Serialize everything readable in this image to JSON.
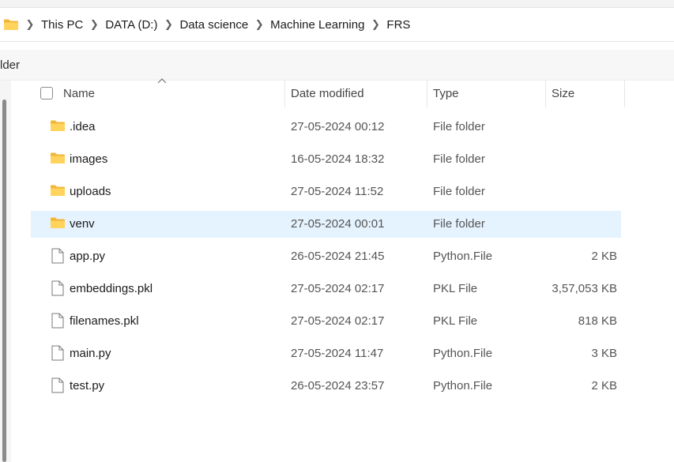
{
  "breadcrumb": [
    "This PC",
    "DATA (D:)",
    "Data science",
    "Machine Learning",
    "FRS"
  ],
  "command_bar": {
    "label": "lder"
  },
  "columns": {
    "name": "Name",
    "date": "Date modified",
    "type": "Type",
    "size": "Size"
  },
  "files": [
    {
      "name": ".idea",
      "date": "27-05-2024 00:12",
      "type": "File folder",
      "size": "",
      "icon": "folder-icon"
    },
    {
      "name": "images",
      "date": "16-05-2024 18:32",
      "type": "File folder",
      "size": "",
      "icon": "folder-icon"
    },
    {
      "name": "uploads",
      "date": "27-05-2024 11:52",
      "type": "File folder",
      "size": "",
      "icon": "folder-icon"
    },
    {
      "name": "venv",
      "date": "27-05-2024 00:01",
      "type": "File folder",
      "size": "",
      "icon": "folder-icon",
      "selected": true
    },
    {
      "name": "app.py",
      "date": "26-05-2024 21:45",
      "type": "Python.File",
      "size": "2 KB",
      "icon": "file-icon"
    },
    {
      "name": "embeddings.pkl",
      "date": "27-05-2024 02:17",
      "type": "PKL File",
      "size": "3,57,053 KB",
      "icon": "file-icon"
    },
    {
      "name": "filenames.pkl",
      "date": "27-05-2024 02:17",
      "type": "PKL File",
      "size": "818 KB",
      "icon": "file-icon"
    },
    {
      "name": "main.py",
      "date": "27-05-2024 11:47",
      "type": "Python.File",
      "size": "3 KB",
      "icon": "file-icon"
    },
    {
      "name": "test.py",
      "date": "26-05-2024 23:57",
      "type": "Python.File",
      "size": "2 KB",
      "icon": "file-icon"
    }
  ],
  "colors": {
    "folder": "#f8c84a",
    "selection": "#e5f3ff"
  }
}
